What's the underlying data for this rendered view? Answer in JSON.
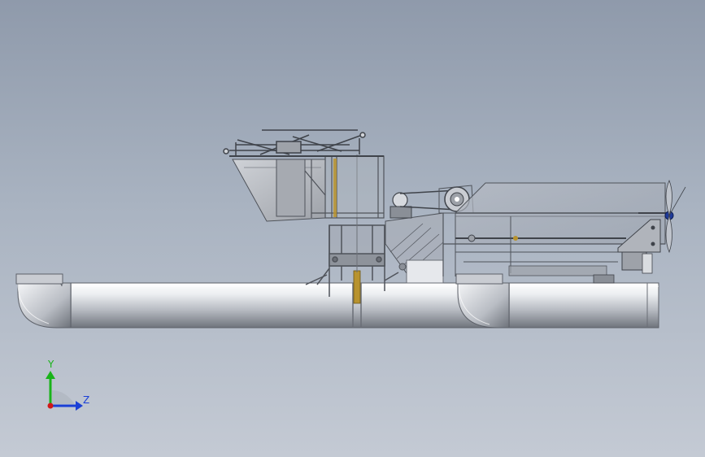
{
  "view": {
    "type": "cad-side-view",
    "triad": {
      "y_label": "Y",
      "z_label": "Z",
      "colors": {
        "y": "#19b319",
        "z": "#1a3fd6",
        "x_origin": "#d01818"
      }
    },
    "colors": {
      "background_top": "#8f9aab",
      "background_bottom": "#c4cad4",
      "pontoon": "#e4e6ea",
      "frame": "#5a5e66",
      "panel": "#b9bcc2",
      "brass": "#b8932e"
    }
  }
}
